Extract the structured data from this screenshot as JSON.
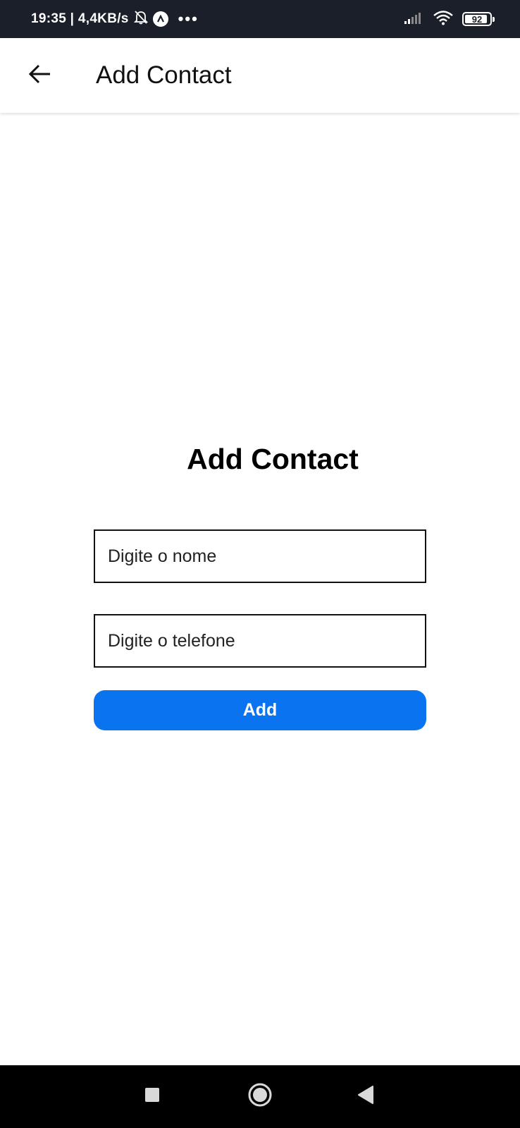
{
  "status_bar": {
    "time_speed": "19:35 | 4,4KB/s",
    "more_dots": "•••",
    "battery": "92",
    "icons": [
      "bell-off-icon",
      "app-notification-icon",
      "signal-icon",
      "wifi-icon",
      "battery-icon"
    ]
  },
  "app_bar": {
    "title": "Add Contact",
    "back_icon": "arrow-left-icon"
  },
  "form": {
    "heading": "Add Contact",
    "name_placeholder": "Digite o nome",
    "phone_placeholder": "Digite o telefone",
    "add_label": "Add"
  },
  "nav_bar": {
    "icons": [
      "recents-square-icon",
      "home-circle-icon",
      "back-triangle-icon"
    ]
  },
  "colors": {
    "status_bar_bg": "#1a1f2a",
    "accent": "#0a73f0",
    "nav_bar_bg": "#000000"
  }
}
